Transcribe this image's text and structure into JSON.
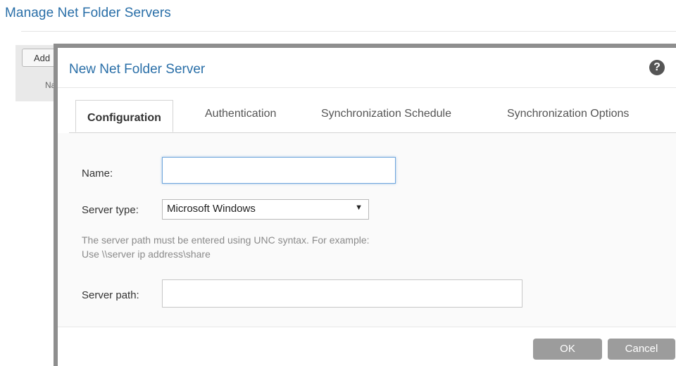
{
  "page": {
    "title": "Manage Net Folder Servers",
    "background_add_label": "Add",
    "background_col_header": "Na"
  },
  "dialog": {
    "title": "New Net Folder Server",
    "help_glyph": "?",
    "tabs": [
      {
        "label": "Configuration",
        "active": true
      },
      {
        "label": "Authentication",
        "active": false
      },
      {
        "label": "Synchronization Schedule",
        "active": false
      },
      {
        "label": "Synchronization Options",
        "active": false
      }
    ],
    "form": {
      "name_label": "Name:",
      "name_value": "",
      "server_type_label": "Server type:",
      "server_type_value": "Microsoft Windows",
      "hint_line1": "The server path must be entered using UNC syntax. For example:",
      "hint_line2": "Use \\\\server ip address\\share",
      "server_path_label": "Server path:",
      "server_path_value": ""
    },
    "buttons": {
      "ok": "OK",
      "cancel": "Cancel"
    }
  },
  "colors": {
    "title_blue": "#2a6fa8",
    "button_gray": "#9c9c9c",
    "focus_blue": "#6fa6dd"
  }
}
